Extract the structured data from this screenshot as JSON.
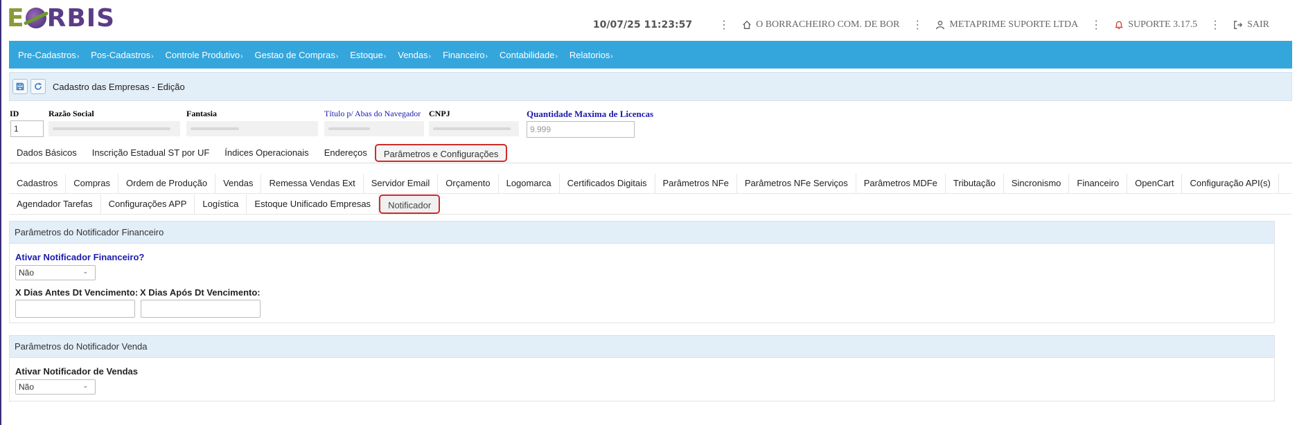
{
  "header": {
    "logo_e": "E",
    "logo_rest": "RBIS",
    "datetime": "10/07/25 11:23:57",
    "company": "O BORRACHEIRO COM. DE BOR",
    "user": "METAPRIME SUPORTE LTDA",
    "support": "SUPORTE 3.17.5",
    "exit": "SAIR",
    "separator": "⋮"
  },
  "menu": {
    "items": [
      {
        "label": "Pre-Cadastros"
      },
      {
        "label": "Pos-Cadastros"
      },
      {
        "label": "Controle Produtivo"
      },
      {
        "label": "Gestao de Compras"
      },
      {
        "label": "Estoque"
      },
      {
        "label": "Vendas"
      },
      {
        "label": "Financeiro"
      },
      {
        "label": "Contabilidade"
      },
      {
        "label": "Relatorios"
      }
    ],
    "arrow": "›"
  },
  "titlebar": {
    "title": "Cadastro das Empresas - Edição",
    "save_icon": "save-icon",
    "refresh_icon": "refresh-icon"
  },
  "fields": {
    "id_label": "ID",
    "id_value": "1",
    "razao_label": "Razão Social",
    "fantasia_label": "Fantasia",
    "titulo_label": "Título p/ Abas do Navegador",
    "cnpj_label": "CNPJ",
    "qtd_label": "Quantidade Maxima de Licencas",
    "qtd_value": "9.999"
  },
  "tabs_main": [
    {
      "label": "Dados Básicos"
    },
    {
      "label": "Inscrição Estadual ST por UF"
    },
    {
      "label": "Índices Operacionais"
    },
    {
      "label": "Endereços"
    },
    {
      "label": "Parâmetros e Configurações",
      "active": true
    }
  ],
  "tabs_sub_row1": [
    {
      "label": "Cadastros"
    },
    {
      "label": "Compras"
    },
    {
      "label": "Ordem de Produção"
    },
    {
      "label": "Vendas"
    },
    {
      "label": "Remessa Vendas Ext"
    },
    {
      "label": "Servidor Email"
    },
    {
      "label": "Orçamento"
    },
    {
      "label": "Logomarca"
    },
    {
      "label": "Certificados Digitais"
    },
    {
      "label": "Parâmetros NFe"
    },
    {
      "label": "Parâmetros NFe Serviços"
    },
    {
      "label": "Parâmetros MDFe"
    },
    {
      "label": "Tributação"
    },
    {
      "label": "Sincronismo"
    },
    {
      "label": "Financeiro"
    },
    {
      "label": "OpenCart"
    },
    {
      "label": "Configuração API(s)"
    }
  ],
  "tabs_sub_row2": [
    {
      "label": "Agendador Tarefas"
    },
    {
      "label": "Configurações APP"
    },
    {
      "label": "Logística"
    },
    {
      "label": "Estoque Unificado Empresas"
    },
    {
      "label": "Notificador",
      "active": true
    }
  ],
  "panel_fin": {
    "title": "Parâmetros do Notificador Financeiro",
    "ativar_label": "Ativar Notificador Financeiro?",
    "ativar_value": "Não",
    "dias_antes_label": "X Dias Antes Dt Vencimento:",
    "dias_apos_label": "X Dias Após Dt Vencimento:",
    "dias_antes_value": "",
    "dias_apos_value": ""
  },
  "panel_vendas": {
    "title": "Parâmetros do Notificador Venda",
    "ativar_label": "Ativar Notificador de Vendas",
    "ativar_value": "Não"
  },
  "colors": {
    "menu_bg": "#35a6dc",
    "titlebar_bg": "#e2eef8",
    "active_tab_border": "#cf2b2b",
    "label_blue": "#1a1ab0"
  }
}
